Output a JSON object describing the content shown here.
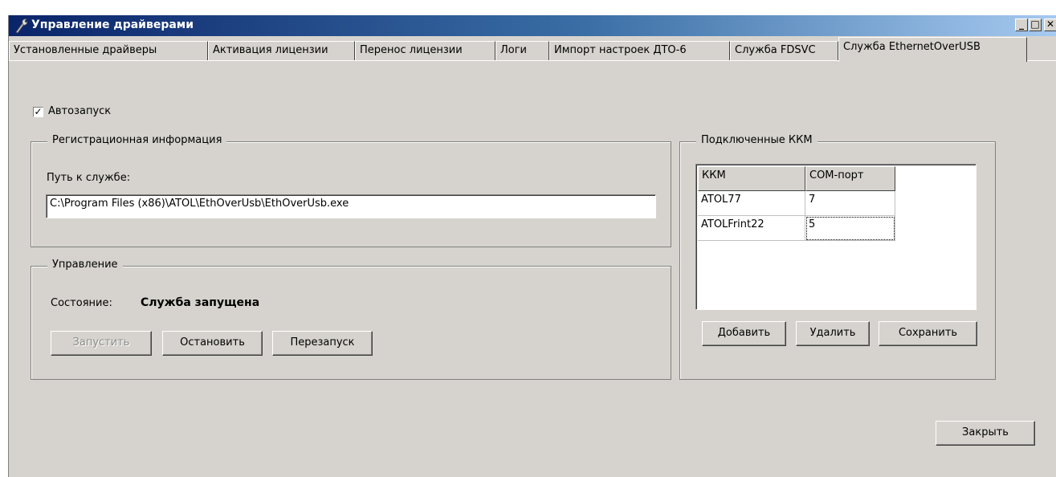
{
  "window": {
    "title": "Управление драйверами",
    "controls": {
      "minimize": "_",
      "maximize": "□",
      "close": "✕"
    }
  },
  "tabs": [
    {
      "label": "Установленные драйверы",
      "active": false
    },
    {
      "label": "Активация лицензии",
      "active": false
    },
    {
      "label": "Перенос лицензии",
      "active": false
    },
    {
      "label": "Логи",
      "active": false
    },
    {
      "label": "Импорт настроек ДТО-6",
      "active": false
    },
    {
      "label": "Служба FDSVC",
      "active": false
    },
    {
      "label": "Служба EthernetOverUSB",
      "active": true
    }
  ],
  "autostart": {
    "label": "Автозапуск",
    "checked": true,
    "mark": "✓"
  },
  "registration": {
    "title": "Регистрационная информация",
    "path_label": "Путь к службе:",
    "path_value": "C:\\Program Files (x86)\\ATOL\\EthOverUsb\\EthOverUsb.exe"
  },
  "control": {
    "title": "Управление",
    "status_label": "Состояние:",
    "status_value": "Служба запущена",
    "start_button": "Запустить",
    "stop_button": "Остановить",
    "restart_button": "Перезапуск"
  },
  "kkm": {
    "title": "Подключенные ККМ",
    "headers": [
      "ККМ",
      "COM-порт"
    ],
    "rows": [
      {
        "name": "ATOL77",
        "port": "7"
      },
      {
        "name": "ATOLFrint22",
        "port": "5"
      }
    ],
    "add_button": "Добавить",
    "delete_button": "Удалить",
    "save_button": "Сохранить"
  },
  "close_button": "Закрыть",
  "colors": {
    "titlebar_start": "#0a246a",
    "titlebar_end": "#a6caf0",
    "face": "#d6d3ce"
  }
}
